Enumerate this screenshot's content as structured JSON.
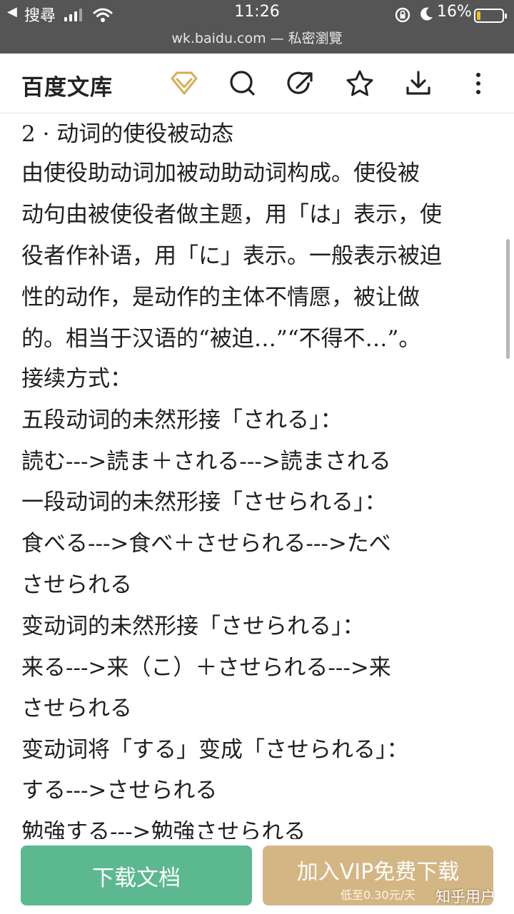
{
  "status_bar": {
    "back_label": "◀",
    "carrier": "搜尋",
    "time": "11:26",
    "battery_percent": "16%",
    "battery_level": 0.16,
    "url": "wk.baidu.com — 私密瀏覽"
  },
  "header": {
    "brand": "百度文库",
    "icons": [
      "vip-diamond-icon",
      "search-icon",
      "share-icon",
      "star-icon",
      "download-icon",
      "more-icon"
    ],
    "accent_color": "#d6ad54"
  },
  "document": {
    "lines": [
      "2 · 动词的使役被动态",
      "  由使役助动词加被动助动词构成。使役被",
      "动句由被使役者做主题，用「は」表示，使",
      "役者作补语，用「に」表示。一般表示被迫",
      "性的动作，是动作的主体不情愿，被让做",
      "的。相当于汉语的“被迫…”“不得不…”。",
      " 接续方式：",
      " 五段动词的未然形接「される」：",
      "     読む--->読ま＋される--->読まされる",
      " 一段动词的未然形接「させられる」：",
      "     食べる--->食べ＋させられる--->たべ",
      "させられる",
      " 变动词的未然形接「させられる」：",
      "     来る--->来（こ）＋させられる--->来",
      "させられる",
      " 变动词将「する」变成「させられる」：",
      "     する--->させられる",
      "     勉強する--->勉強させられる"
    ]
  },
  "bottom": {
    "download_label": "下载文档",
    "vip_label": "加入VIP免费下载",
    "vip_sublabel": "低至0.30元/天",
    "download_color": "#5cb88f",
    "vip_color": "#d4b684"
  },
  "watermark": "知乎用户"
}
